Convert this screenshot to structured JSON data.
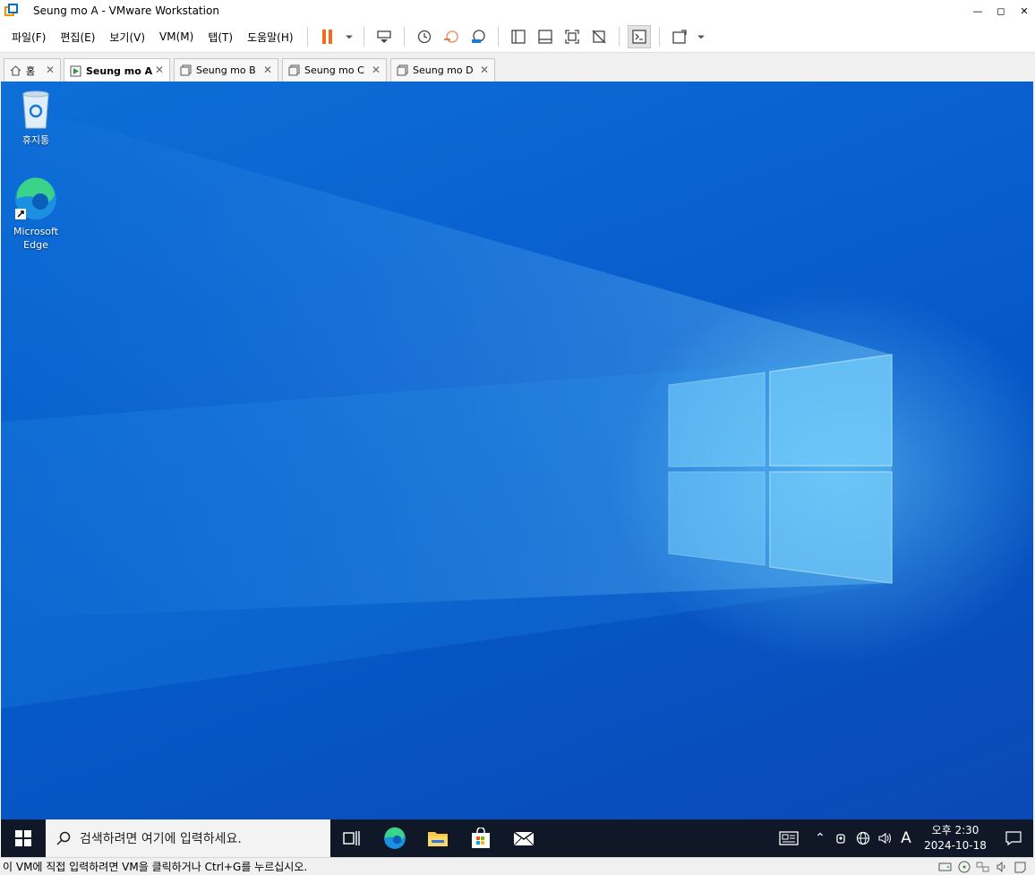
{
  "window": {
    "title": "Seung mo A - VMware Workstation"
  },
  "menu": {
    "items": [
      "파일(F)",
      "편집(E)",
      "보기(V)",
      "VM(M)",
      "탭(T)",
      "도움말(H)"
    ]
  },
  "tabs": [
    {
      "label": "홈"
    },
    {
      "label": "Seung mo A"
    },
    {
      "label": "Seung mo B"
    },
    {
      "label": "Seung mo C"
    },
    {
      "label": "Seung mo D"
    }
  ],
  "desktop": {
    "icons": [
      {
        "label": "휴지통"
      },
      {
        "label": "Microsoft Edge"
      }
    ]
  },
  "taskbar": {
    "search_placeholder": "검색하려면 여기에 입력하세요.",
    "ime": "A",
    "time": "오후 2:30",
    "date": "2024-10-18"
  },
  "status": {
    "text": "이 VM에 직접 입력하려면 VM을 클릭하거나 Ctrl+G를 누르십시오."
  },
  "colors": {
    "pause_accent": "#f26b1d",
    "desktop_blue": "#0a62d0",
    "taskbar_bg": "#101828"
  }
}
